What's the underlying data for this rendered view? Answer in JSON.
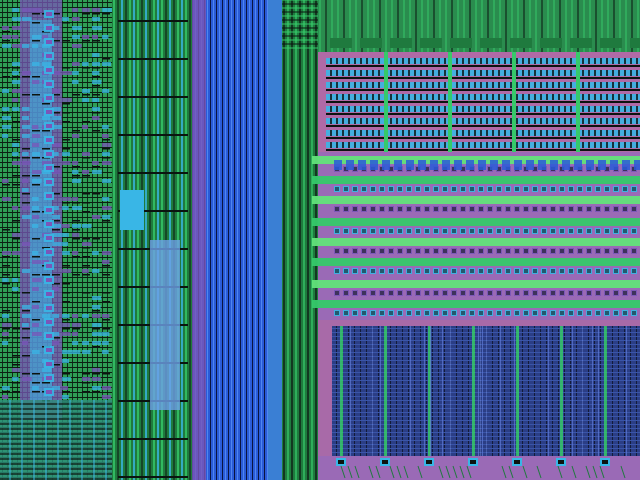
{
  "image": {
    "subject": "die-micrograph",
    "regions": [
      {
        "name": "left-logic-column"
      },
      {
        "name": "vertical-bus-channel"
      },
      {
        "name": "wide-blue-bus"
      },
      {
        "name": "routing-channel"
      },
      {
        "name": "horizontal-driver-array"
      },
      {
        "name": "memory-cell-array"
      }
    ],
    "colors": {
      "metal_green": "#36c96a",
      "metal_green_dark": "#1f7a3e",
      "metal_cyan": "#39b6e6",
      "metal_blue": "#2a5bd8",
      "poly_purple": "#7a56b8",
      "diffusion_pink": "#b06aa6",
      "substrate_dark": "#1a2430",
      "array_navy": "#2b3e86",
      "trace_black": "#0b1410"
    }
  }
}
